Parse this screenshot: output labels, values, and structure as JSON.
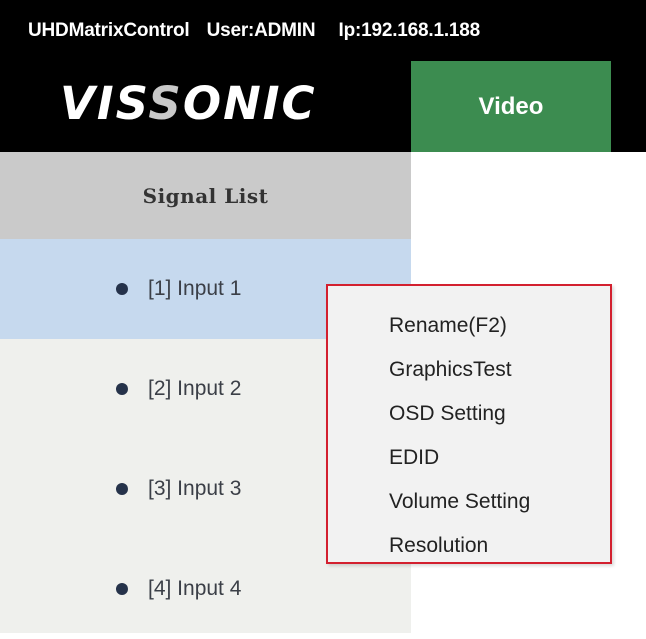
{
  "header": {
    "app_name": "UHDMatrixControl",
    "user": "User:ADMIN",
    "ip": "Ip:192.168.1.188",
    "logo_text_before": "VIS",
    "logo_text_accent": "S",
    "logo_text_after": "ONIC"
  },
  "tabs": [
    {
      "label": "Video",
      "active": true
    }
  ],
  "sidebar": {
    "title": "Signal List",
    "items": [
      {
        "label": "[1] Input 1",
        "selected": true
      },
      {
        "label": "[2] Input 2",
        "selected": false
      },
      {
        "label": "[3] Input 3",
        "selected": false
      },
      {
        "label": "[4] Input 4",
        "selected": false
      }
    ]
  },
  "context_menu": {
    "items": [
      "Rename(F2)",
      "GraphicsTest",
      "OSD Setting",
      "EDID",
      "Volume Setting",
      "Resolution"
    ]
  },
  "colors": {
    "header_bg": "#000000",
    "tab_active": "#3c8c50",
    "selected_row": "#c6d9ee",
    "menu_border": "#d3202f"
  }
}
